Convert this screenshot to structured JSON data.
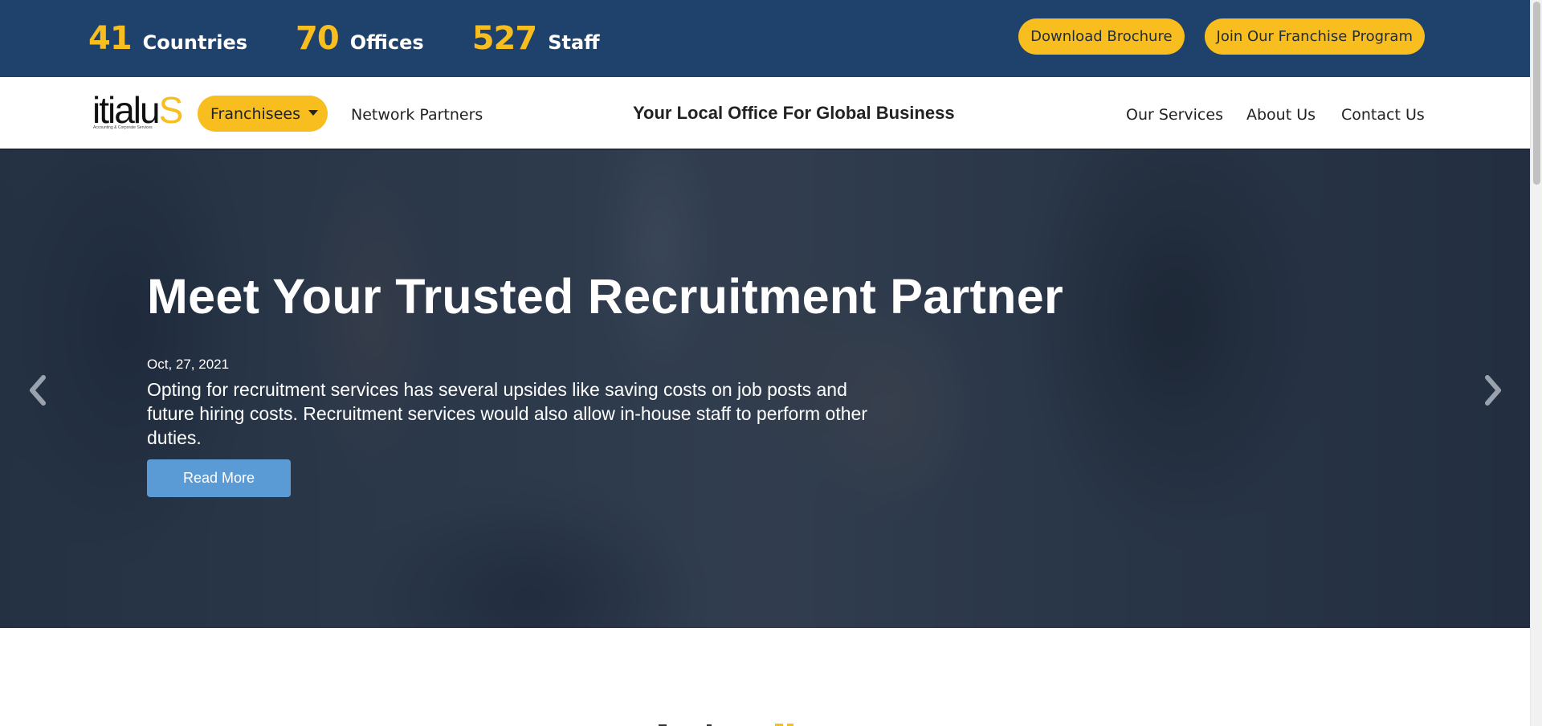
{
  "topbar": {
    "stats": [
      {
        "number": "41",
        "label": "Countries"
      },
      {
        "number": "70",
        "label": "Offices"
      },
      {
        "number": "527",
        "label": "Staff"
      }
    ],
    "download_brochure": "Download Brochure",
    "join_franchise": "Join Our Franchise Program"
  },
  "navbar": {
    "logo_text_main": "itialu",
    "logo_text_s": "S",
    "logo_tagline": "Accounting & Corporate Services",
    "franchisees": "Franchisees",
    "network_partners": "Network Partners",
    "tagline": "Your Local Office For Global Business",
    "links": [
      "Our Services",
      "About Us",
      "Contact Us"
    ]
  },
  "hero": {
    "title": "Meet Your Trusted Recruitment Partner",
    "date": "Oct, 27, 2021",
    "description": "Opting for recruitment services has several upsides like saving costs on job posts and future hiring costs. Recruitment services would also allow in-house staff to perform other duties.",
    "read_more": "Read More",
    "prev_icon": "chevron-left-icon",
    "next_icon": "chevron-right-icon"
  },
  "colors": {
    "topbar_bg": "#1f426d",
    "accent_yellow": "#f8bd1e",
    "read_more_blue": "#5b9bd5"
  }
}
